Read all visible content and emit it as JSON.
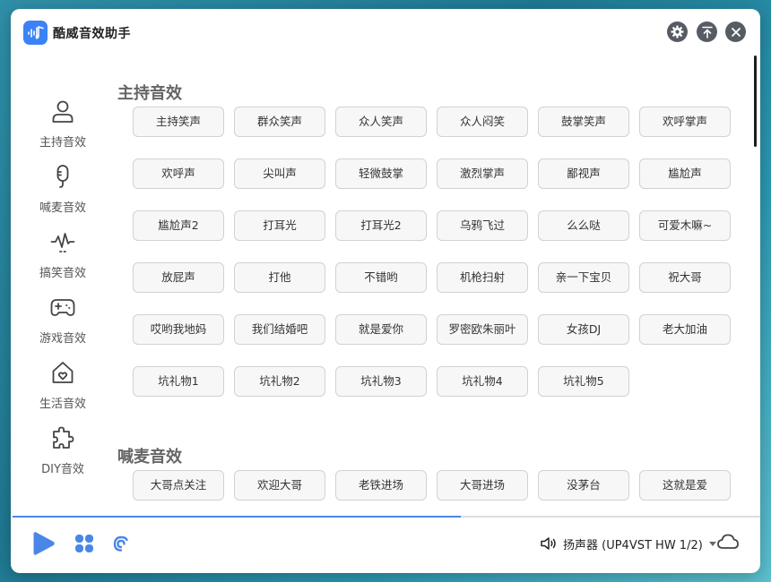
{
  "app": {
    "title": "酷威音效助手"
  },
  "sidebar": {
    "items": [
      {
        "label": "主持音效",
        "icon": "person-icon"
      },
      {
        "label": "喊麦音效",
        "icon": "microphone-icon"
      },
      {
        "label": "搞笑音效",
        "icon": "funny-wave-icon"
      },
      {
        "label": "游戏音效",
        "icon": "gamepad-icon"
      },
      {
        "label": "生活音效",
        "icon": "home-heart-icon"
      },
      {
        "label": "DIY音效",
        "icon": "puzzle-icon"
      }
    ]
  },
  "sections": [
    {
      "title": "主持音效",
      "buttons": [
        "主持笑声",
        "群众笑声",
        "众人笑声",
        "众人闷笑",
        "鼓掌笑声",
        "欢呼掌声",
        "欢呼声",
        "尖叫声",
        "轻微鼓掌",
        "激烈掌声",
        "鄙视声",
        "尴尬声",
        "尴尬声2",
        "打耳光",
        "打耳光2",
        "乌鸦飞过",
        "么么哒",
        "可爱木嘛~",
        "放屁声",
        "打他",
        "不错哟",
        "机枪扫射",
        "亲一下宝贝",
        "祝大哥",
        "哎哟我地妈",
        "我们结婚吧",
        "就是爱你",
        "罗密欧朱丽叶",
        "女孩DJ",
        "老大加油",
        "坑礼物1",
        "坑礼物2",
        "坑礼物3",
        "坑礼物4",
        "坑礼物5"
      ]
    },
    {
      "title": "喊麦音效",
      "buttons": [
        "大哥点关注",
        "欢迎大哥",
        "老铁进场",
        "大哥进场",
        "没茅台",
        "这就是爱"
      ]
    }
  ],
  "player": {
    "progress": 0.6
  },
  "output": {
    "device_label": "扬声器 (UP4VST HW 1/2)"
  },
  "colors": {
    "accent": "#3b82f6",
    "title_button": "#575b63"
  }
}
